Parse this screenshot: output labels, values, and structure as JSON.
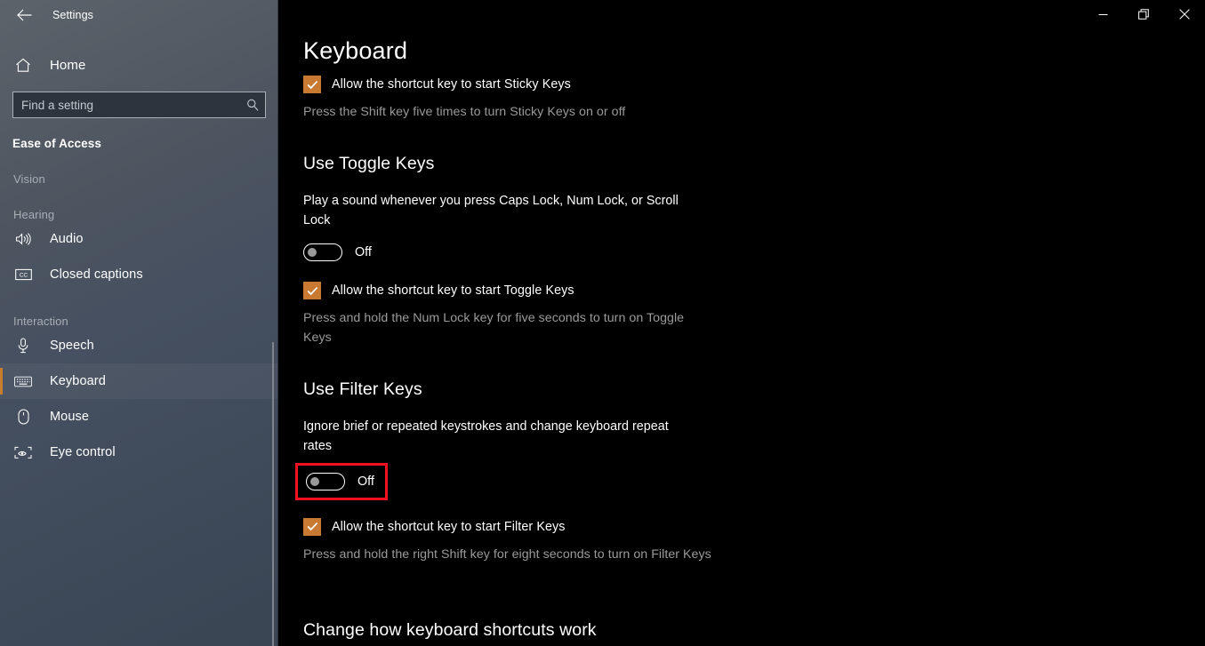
{
  "window": {
    "title": "Settings",
    "back_icon": "back-arrow-icon",
    "controls": {
      "minimize": "minimize-icon",
      "restore": "restore-icon",
      "close": "close-icon"
    }
  },
  "sidebar": {
    "home_label": "Home",
    "home_icon": "home-icon",
    "search": {
      "placeholder": "Find a setting",
      "value": "",
      "icon": "search-icon"
    },
    "section_title": "Ease of Access",
    "groups": [
      {
        "header": "Vision",
        "items": []
      },
      {
        "header": "Hearing",
        "items": [
          {
            "label": "Audio",
            "icon": "speaker-icon",
            "selected": false
          },
          {
            "label": "Closed captions",
            "icon": "closed-captions-icon",
            "selected": false
          }
        ]
      },
      {
        "header": "Interaction",
        "items": [
          {
            "label": "Speech",
            "icon": "microphone-icon",
            "selected": false
          },
          {
            "label": "Keyboard",
            "icon": "keyboard-icon",
            "selected": true
          },
          {
            "label": "Mouse",
            "icon": "mouse-icon",
            "selected": false
          },
          {
            "label": "Eye control",
            "icon": "eye-control-icon",
            "selected": false
          }
        ]
      }
    ],
    "accent_color": "#c87d2f"
  },
  "main": {
    "page_title": "Keyboard",
    "sticky_keys": {
      "checkbox_label": "Allow the shortcut key to start Sticky Keys",
      "checkbox_checked": true,
      "hint": "Press the Shift key five times to turn Sticky Keys on or off"
    },
    "toggle_keys": {
      "heading": "Use Toggle Keys",
      "description": "Play a sound whenever you press Caps Lock, Num Lock, or Scroll Lock",
      "toggle_state": "Off",
      "toggle_on": false,
      "checkbox_label": "Allow the shortcut key to start Toggle Keys",
      "checkbox_checked": true,
      "hint": "Press and hold the Num Lock key for five seconds to turn on Toggle Keys"
    },
    "filter_keys": {
      "heading": "Use Filter Keys",
      "description": "Ignore brief or repeated keystrokes and change keyboard repeat rates",
      "toggle_state": "Off",
      "toggle_on": false,
      "highlighted": true,
      "highlight_color": "#f01020",
      "checkbox_label": "Allow the shortcut key to start Filter Keys",
      "checkbox_checked": true,
      "hint": "Press and hold the right Shift key for eight seconds to turn on Filter Keys"
    },
    "shortcuts_heading": "Change how keyboard shortcuts work",
    "checkbox_color": "#c87a33"
  }
}
